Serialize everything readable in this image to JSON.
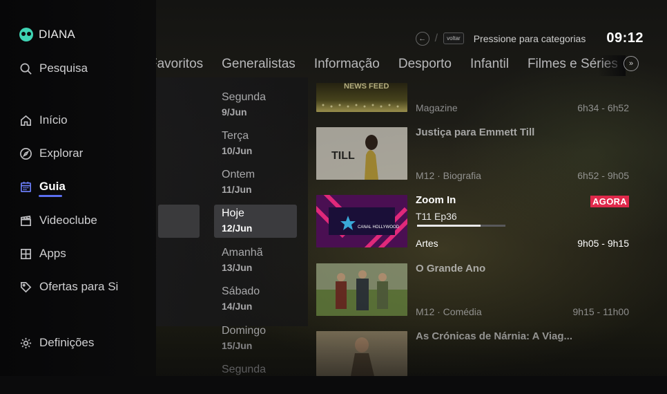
{
  "profile": {
    "name": "DIANA"
  },
  "nav": {
    "search": "Pesquisa",
    "home": "Início",
    "explore": "Explorar",
    "guide": "Guia",
    "videoclub": "Videoclube",
    "apps": "Apps",
    "offers": "Ofertas para Si",
    "settings": "Definições"
  },
  "topbar": {
    "back_key": "voltar",
    "hint": "Pressione para categorias",
    "clock": "09:12"
  },
  "tabs": [
    "Favoritos",
    "Generalistas",
    "Informação",
    "Desporto",
    "Infantil",
    "Filmes e Séries"
  ],
  "days": [
    {
      "weekday": "Segunda",
      "date": "9/Jun"
    },
    {
      "weekday": "Terça",
      "date": "10/Jun"
    },
    {
      "weekday": "Ontem",
      "date": "11/Jun"
    },
    {
      "weekday": "Hoje",
      "date": "12/Jun"
    },
    {
      "weekday": "Amanhã",
      "date": "13/Jun"
    },
    {
      "weekday": "Sábado",
      "date": "14/Jun"
    },
    {
      "weekday": "Domingo",
      "date": "15/Jun"
    },
    {
      "weekday": "Segunda",
      "date": ""
    }
  ],
  "programs": [
    {
      "title": "",
      "meta": "Magazine",
      "time": "6h34 - 6h52",
      "thumb_text": "NEWS FEED"
    },
    {
      "title": "Justiça para Emmett Till",
      "meta": "M12 · Biografia",
      "time": "6h52 - 9h05",
      "thumb_text": "TILL"
    },
    {
      "title": "Zoom In",
      "episode": "T11 Ep36",
      "meta": "Artes",
      "time": "9h05 - 9h15",
      "badge": "AGORA",
      "progress": 0.72,
      "thumb_text": "CANAL HOLLYWOOD"
    },
    {
      "title": "O Grande Ano",
      "meta": "M12 · Comédia",
      "time": "9h15 - 11h00"
    },
    {
      "title": "As Crónicas de Nárnia: A Viag...",
      "meta": "",
      "time": ""
    }
  ],
  "colors": {
    "accent": "#5b6ff0",
    "live_badge": "#e0294b",
    "avatar": "#3fd4b4"
  }
}
